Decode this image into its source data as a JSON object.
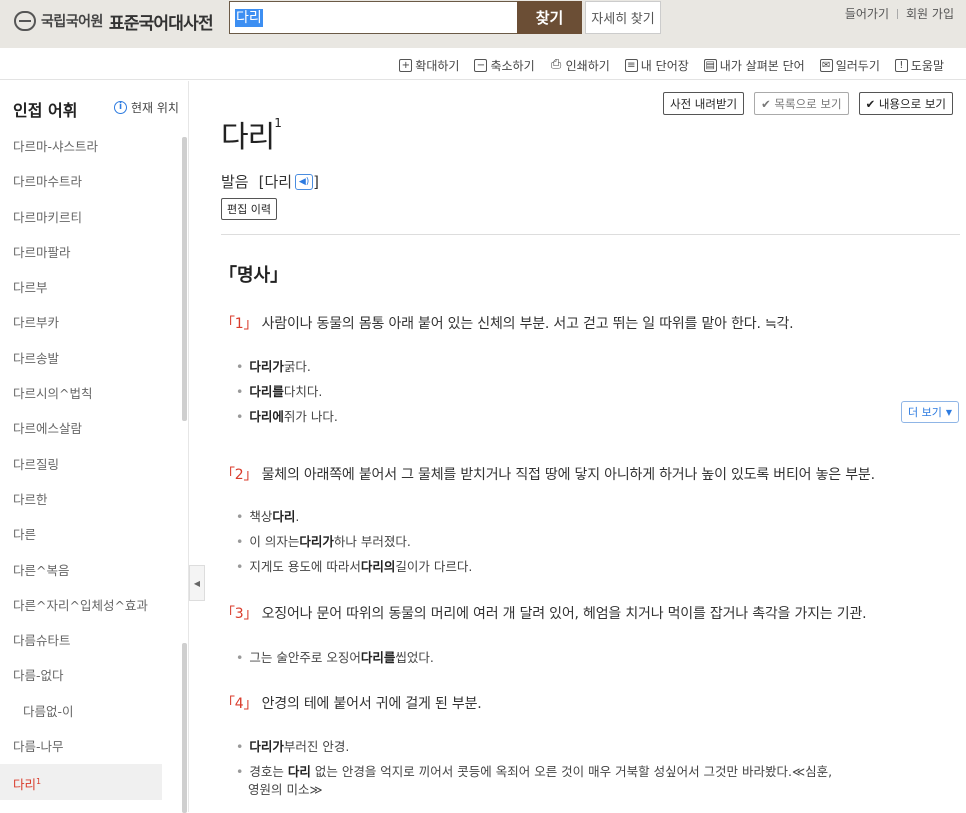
{
  "header": {
    "logo_org": "국립국어원",
    "logo_title": "표준국어대사전",
    "search_value": "다리",
    "search_button": "찾기",
    "advanced_button": "자세히 찾기",
    "login": "들어가기",
    "signup": "회원 가입"
  },
  "toolbar": {
    "items": [
      {
        "icon": "+",
        "label": "확대하기"
      },
      {
        "icon": "−",
        "label": "축소하기"
      },
      {
        "icon": "⎙",
        "label": "인쇄하기"
      },
      {
        "icon": "≡",
        "label": "내 단어장"
      },
      {
        "icon": "▤",
        "label": "내가 살펴본 단어"
      },
      {
        "icon": "✉",
        "label": "일러두기"
      },
      {
        "icon": "!",
        "label": "도움말"
      }
    ]
  },
  "sidebar": {
    "title": "인접 어휘",
    "current_location": "현재 위치",
    "items": [
      "다르마-샤스트라",
      "다르마수트라",
      "다르마키르티",
      "다르마팔라",
      "다르부",
      "다르부카",
      "다르송발",
      "다르시의^법칙",
      "다르에스살람",
      "다르질링",
      "다르한",
      "다른",
      "다른^복음",
      "다른^자리^입체성^효과",
      "다름슈타트",
      "다름-없다",
      "다름없-이",
      "다름-나무"
    ],
    "active_item": "다리",
    "active_sup": "1"
  },
  "main": {
    "view_buttons": {
      "download": "사전 내려받기",
      "list_view": "✔ 목록으로 보기",
      "content_view": "✔ 내용으로 보기"
    },
    "word": "다리",
    "word_sup": "1",
    "pron_label": "발음",
    "pron_value": "[다리",
    "pron_close": "]",
    "edit_history": "편집 이력",
    "pos": "「명사」",
    "more_button": "더 보기",
    "senses": [
      {
        "num": "「1」",
        "def": "사람이나 동물의 몸통 아래 붙어 있는 신체의 부분. 서고 걷고 뛰는 일 따위를 맡아 한다. ≒각.",
        "examples": [
          {
            "bold": "다리가",
            "rest": " 굵다."
          },
          {
            "bold": "다리를",
            "rest": " 다치다."
          },
          {
            "bold": "다리에",
            "rest": " 쥐가 나다."
          }
        ]
      },
      {
        "num": "「2」",
        "def": "물체의 아래쪽에 붙어서 그 물체를 받치거나 직접 땅에 닿지 아니하게 하거나 높이 있도록 버티어 놓은 부분.",
        "examples": [
          {
            "pre": "책상 ",
            "bold": "다리",
            "rest": "."
          },
          {
            "pre": "이 의자는 ",
            "bold": "다리가",
            "rest": " 하나 부러졌다."
          },
          {
            "pre": "지게도 용도에 따라서 ",
            "bold": "다리의",
            "rest": " 길이가 다르다."
          }
        ]
      },
      {
        "num": "「3」",
        "def": "오징어나 문어 따위의 동물의 머리에 여러 개 달려 있어, 헤엄을 치거나 먹이를 잡거나 촉각을 가지는 기관.",
        "examples": [
          {
            "pre": "그는 술안주로 오징어 ",
            "bold": "다리를",
            "rest": " 씹었다."
          }
        ]
      },
      {
        "num": "「4」",
        "def": "안경의 테에 붙어서 귀에 걸게 된 부분.",
        "examples": [
          {
            "bold": "다리가",
            "rest": " 부러진 안경."
          },
          {
            "pre": "경호는 ",
            "bold": "다리",
            "rest": " 없는 안경을 억지로 끼어서 콧등에 옥죄어 오른 것이 매우 거북할 성싶어서 그것만 바라봤다.≪심훈,",
            "line2": "영원의 미소≫"
          }
        ]
      }
    ]
  }
}
